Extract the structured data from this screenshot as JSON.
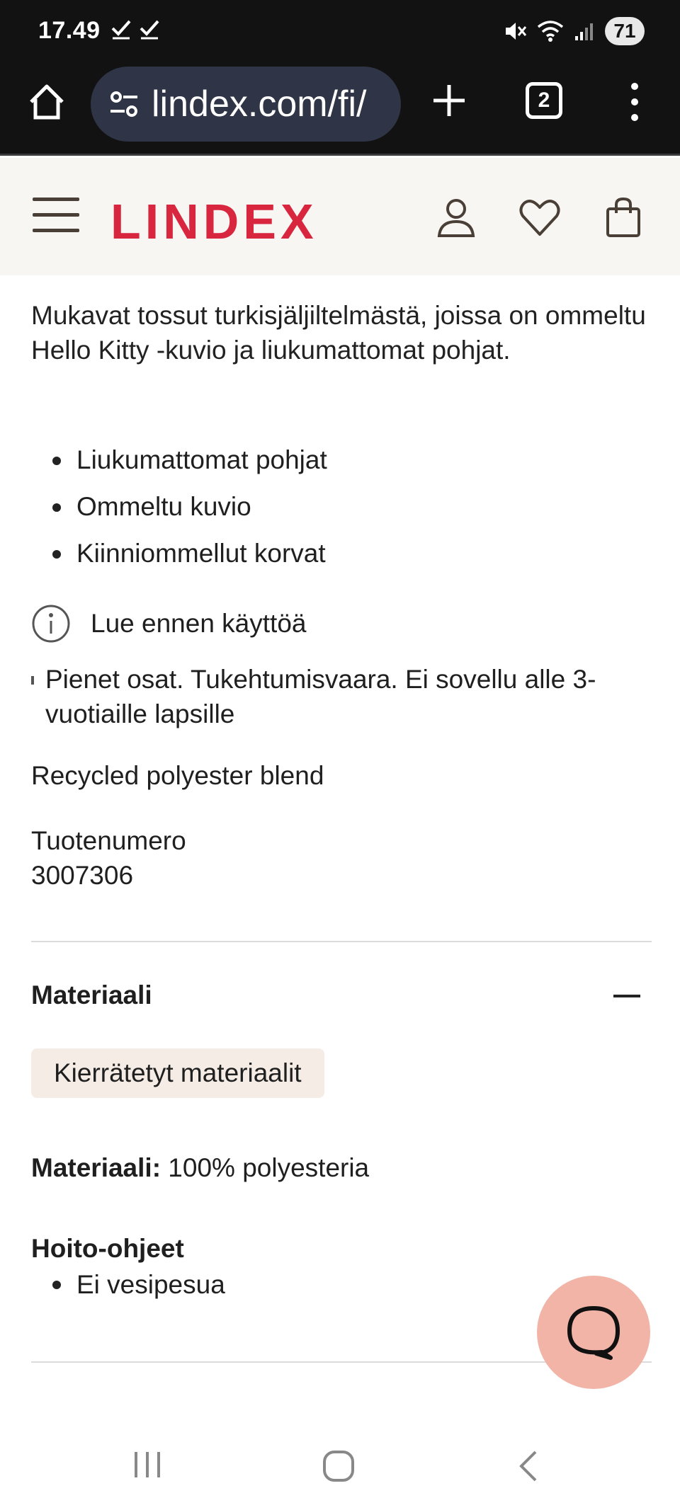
{
  "status_bar": {
    "time": "17.49",
    "battery": "71",
    "icons": [
      "check-icon",
      "check-icon",
      "mute-icon",
      "wifi-icon",
      "signal-icon"
    ]
  },
  "browser": {
    "url": "lindex.com/fi/",
    "tab_count": "2",
    "icons": [
      "home-icon",
      "site-settings-icon",
      "new-tab-icon",
      "menu-dots-icon"
    ]
  },
  "site_header": {
    "logo": "LINDEX",
    "icons": [
      "hamburger-menu-icon",
      "account-icon",
      "wishlist-heart-icon",
      "shopping-bag-icon"
    ]
  },
  "product": {
    "description": "Mukavat tossut turkisjäljiltelmästä, joissa on ommeltu Hello Kitty -kuvio ja liukumattomat pohjat.",
    "features": [
      "Liukumattomat pohjat",
      "Ommeltu kuvio",
      "Kiinniommellut korvat"
    ],
    "info_label": "Lue ennen käyttöä",
    "warning": "Pienet osat. Tukehtumisvaara. Ei sovellu alle 3-vuotiaille lapsille",
    "blend": "Recycled polyester blend",
    "product_number_label": "Tuotenumero",
    "product_number": "3007306"
  },
  "material_section": {
    "title": "Materiaali",
    "tag": "Kierrätetyt materiaalit",
    "material_label": "Materiaali:",
    "material_value": " 100% polyesteria",
    "care_title": "Hoito-ohjeet",
    "care_items": [
      "Ei vesipesua"
    ]
  },
  "colors": {
    "brand_red": "#d7263d",
    "header_bg": "#f8f6f2",
    "chat_fab": "#f1b4a6",
    "tag_bg": "#f5ece6",
    "browser_bg": "#121212"
  },
  "nav_bar": {
    "icons": [
      "recent-apps-icon",
      "home-nav-icon",
      "back-nav-icon"
    ]
  }
}
